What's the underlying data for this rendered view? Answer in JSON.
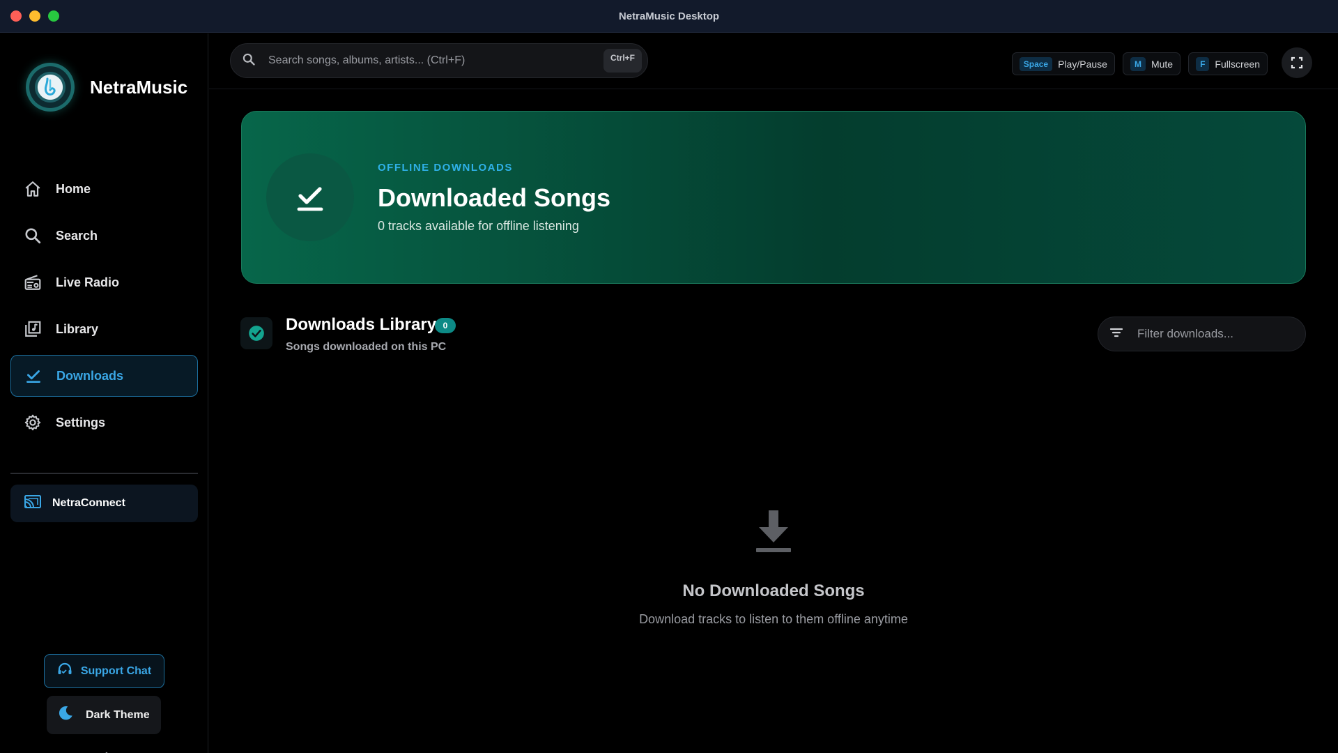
{
  "window": {
    "title": "NetraMusic Desktop"
  },
  "brand": {
    "name": "NetraMusic"
  },
  "nav": {
    "items": [
      {
        "label": "Home",
        "icon": "home-icon"
      },
      {
        "label": "Search",
        "icon": "search-icon"
      },
      {
        "label": "Live Radio",
        "icon": "radio-icon"
      },
      {
        "label": "Library",
        "icon": "library-icon"
      },
      {
        "label": "Downloads",
        "icon": "download-check-icon",
        "active": true
      },
      {
        "label": "Settings",
        "icon": "gear-icon"
      }
    ],
    "connect_label": "NetraConnect"
  },
  "sidebar_footer": {
    "support_label": "Support Chat",
    "theme_label": "Dark Theme"
  },
  "topbar": {
    "search_placeholder": "Search songs, albums, artists... (Ctrl+F)",
    "search_shortcut": "Ctrl+F",
    "shortcuts": [
      {
        "key": "Space",
        "label": "Play/Pause"
      },
      {
        "key": "M",
        "label": "Mute"
      },
      {
        "key": "F",
        "label": "Fullscreen"
      }
    ]
  },
  "hero": {
    "eyebrow": "OFFLINE DOWNLOADS",
    "title": "Downloaded Songs",
    "subtitle": "0 tracks available for offline listening"
  },
  "library": {
    "title": "Downloads Library",
    "count": "0",
    "subtitle": "Songs downloaded on this PC",
    "filter_placeholder": "Filter downloads..."
  },
  "empty_state": {
    "title": "No Downloaded Songs",
    "subtitle": "Download tracks to listen to them offline anytime"
  },
  "colors": {
    "accent": "#3aa7e6",
    "hero_green": "#07664a",
    "badge_teal": "#0d8a86"
  }
}
